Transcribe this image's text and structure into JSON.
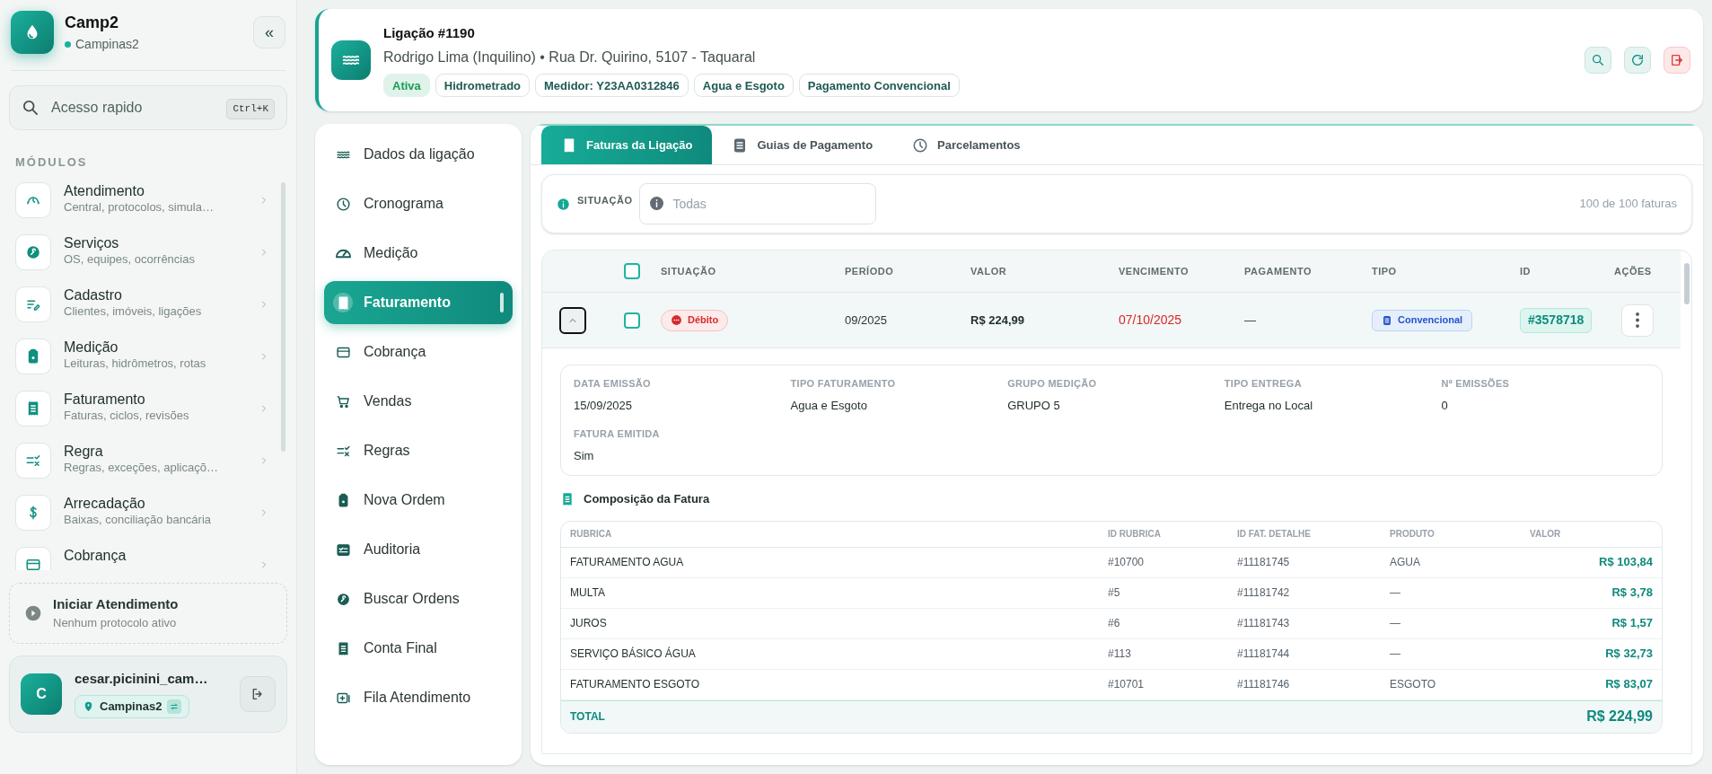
{
  "sidebar": {
    "app_name": "Camp2",
    "location": "Campinas2",
    "collapse_label": "«",
    "search": {
      "placeholder": "Acesso rapido",
      "shortcut": "Ctrl+K"
    },
    "section_label": "MÓDULOS",
    "modules": [
      {
        "title": "Atendimento",
        "subtitle": "Central, protocolos, simula…"
      },
      {
        "title": "Serviços",
        "subtitle": "OS, equipes, ocorrências"
      },
      {
        "title": "Cadastro",
        "subtitle": "Clientes, imóveis, ligações"
      },
      {
        "title": "Medição",
        "subtitle": "Leituras, hidrômetros, rotas"
      },
      {
        "title": "Faturamento",
        "subtitle": "Faturas, ciclos, revisões"
      },
      {
        "title": "Regra",
        "subtitle": "Regras, exceções, aplicaçõ…"
      },
      {
        "title": "Arrecadação",
        "subtitle": "Baixas, conciliação bancária"
      },
      {
        "title": "Cobrança"
      }
    ],
    "start_card": {
      "title": "Iniciar Atendimento",
      "subtitle": "Nenhum protocolo ativo"
    },
    "user": {
      "avatar_letter": "C",
      "name": "cesar.picinini_cam…",
      "location": "Campinas2"
    }
  },
  "header": {
    "title": "Ligação #1190",
    "subtitle": "Rodrigo Lima (Inquilino) • Rua Dr. Quirino, 5107 - Taquaral",
    "tags": [
      {
        "label": "Ativa",
        "kind": "status"
      },
      {
        "label": "Hidrometrado",
        "kind": "info"
      },
      {
        "label": "Medidor: Y23AA0312846",
        "kind": "info"
      },
      {
        "label": "Agua e Esgoto",
        "kind": "info"
      },
      {
        "label": "Pagamento Convencional",
        "kind": "info"
      }
    ]
  },
  "nav": [
    {
      "label": "Dados da ligação",
      "selected": false
    },
    {
      "label": "Cronograma",
      "selected": false
    },
    {
      "label": "Medição",
      "selected": false
    },
    {
      "label": "Faturamento",
      "selected": true
    },
    {
      "label": "Cobrança",
      "selected": false
    },
    {
      "label": "Vendas",
      "selected": false
    },
    {
      "label": "Regras",
      "selected": false
    },
    {
      "label": "Nova Ordem",
      "selected": false
    },
    {
      "label": "Auditoria",
      "selected": false
    },
    {
      "label": "Buscar Ordens",
      "selected": false
    },
    {
      "label": "Conta Final",
      "selected": false
    },
    {
      "label": "Fila Atendimento",
      "selected": false
    }
  ],
  "tabs": [
    {
      "label": "Faturas da Ligação",
      "selected": true
    },
    {
      "label": "Guias de Pagamento",
      "selected": false
    },
    {
      "label": "Parcelamentos",
      "selected": false
    }
  ],
  "filter": {
    "label": "SITUAÇÃO",
    "placeholder": "Todas",
    "count": "100 de 100 faturas"
  },
  "invoices": {
    "all_checked": false,
    "columns": [
      "SITUAÇÃO",
      "PERÍODO",
      "VALOR",
      "VENCIMENTO",
      "PAGAMENTO",
      "TIPO",
      "ID",
      "AÇÕES"
    ],
    "rows": [
      {
        "expanded": true,
        "checked": false,
        "status": {
          "label": "Débito",
          "kind": "danger"
        },
        "period": "09/2025",
        "value": "R$ 224,99",
        "due": "07/10/2025",
        "overdue": true,
        "payment": "—",
        "type": "Convencional",
        "id": "#3578718",
        "details": [
          {
            "label": "DATA EMISSÃO",
            "value": "15/09/2025"
          },
          {
            "label": "TIPO FATURAMENTO",
            "value": "Agua e Esgoto"
          },
          {
            "label": "GRUPO MEDIÇÃO",
            "value": "GRUPO 5"
          },
          {
            "label": "TIPO ENTREGA",
            "value": "Entrega no Local"
          },
          {
            "label": "Nº EMISSÕES",
            "value": "0"
          },
          {
            "label": "FATURA EMITIDA",
            "value": "Sim"
          }
        ],
        "composition": {
          "title": "Composição da Fatura",
          "columns": [
            "RUBRICA",
            "ID RUBRICA",
            "ID FAT. DETALHE",
            "PRODUTO",
            "VALOR"
          ],
          "rows": [
            [
              "FATURAMENTO AGUA",
              "#10700",
              "#11181745",
              "AGUA",
              "R$ 103,84"
            ],
            [
              "MULTA",
              "#5",
              "#11181742",
              "—",
              "R$ 3,78"
            ],
            [
              "JUROS",
              "#6",
              "#11181743",
              "—",
              "R$ 1,57"
            ],
            [
              "SERVIÇO BÁSICO ÁGUA",
              "#113",
              "#11181744",
              "—",
              "R$ 32,73"
            ],
            [
              "FATURAMENTO ESGOTO",
              "#10701",
              "#11181746",
              "ESGOTO",
              "R$ 83,07"
            ]
          ],
          "total_label": "TOTAL",
          "total": "R$ 224,99"
        }
      }
    ]
  }
}
